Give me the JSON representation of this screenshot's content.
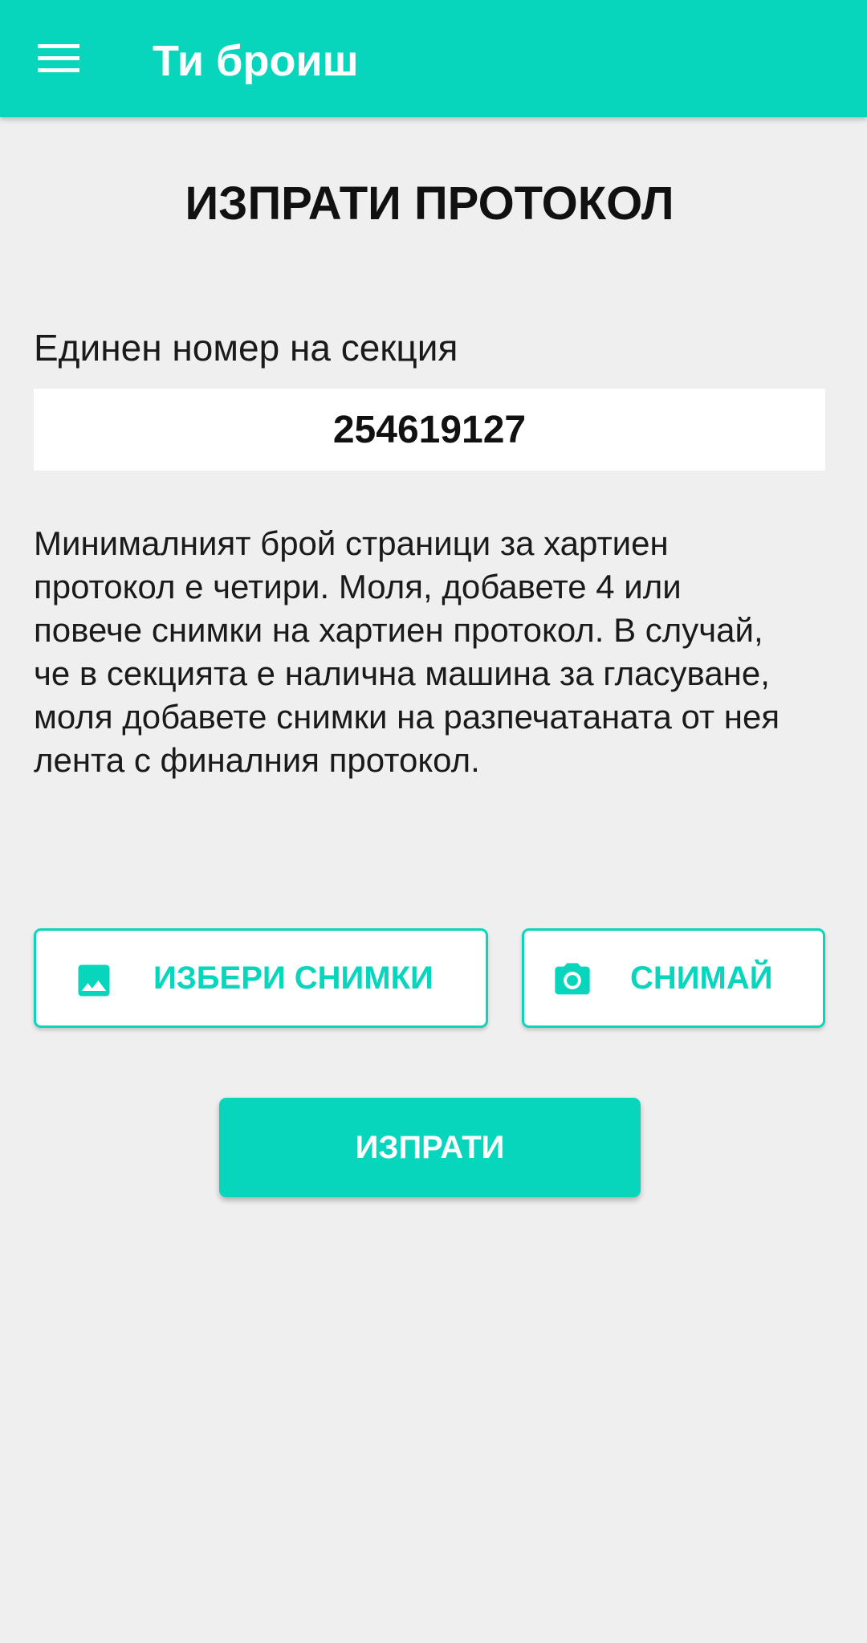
{
  "app_bar": {
    "title": "Ти броиш",
    "menu_icon": "hamburger-menu-icon",
    "background_color": "#07d6bd"
  },
  "page": {
    "title": "ИЗПРАТИ ПРОТОКОЛ",
    "section_label": "Единен номер на секция",
    "section_number": "254619127",
    "instructions": "Минималният брой страници за хартиен протокол е четири. Моля, добавете 4 или повече снимки на хартиен протокол. В случай, че в секцията е налична машина за гласуване, моля добавете снимки на разпечатаната от нея лента с финалния протокол."
  },
  "buttons": {
    "choose_photos": {
      "label": "ИЗБЕРИ СНИМКИ",
      "icon": "image-icon"
    },
    "take_photo": {
      "label": "СНИМАЙ",
      "icon": "camera-icon"
    },
    "send": {
      "label": "ИЗПРАТИ"
    }
  },
  "colors": {
    "accent": "#07d6bd",
    "background": "#efefef",
    "text": "#1a1a1a"
  }
}
